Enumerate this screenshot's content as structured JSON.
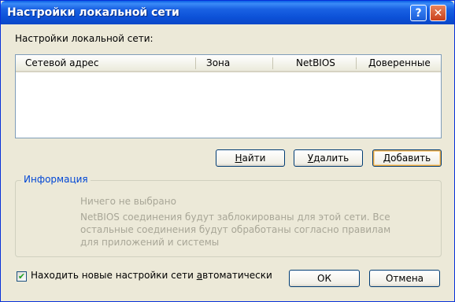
{
  "window": {
    "title": "Настройки локальной сети",
    "help_glyph": "?",
    "close_glyph": "✕"
  },
  "section_label": "Настройки локальной сети:",
  "table": {
    "columns": [
      "Сетевой адрес",
      "Зона",
      "NetBIOS",
      "Доверенные"
    ],
    "rows": []
  },
  "buttons": {
    "find": {
      "label_pre": "",
      "label_accel": "Н",
      "label_post": "айти"
    },
    "delete": {
      "label_pre": "",
      "label_accel": "У",
      "label_post": "далить"
    },
    "add": {
      "label_pre": "",
      "label_accel": "Д",
      "label_post": "обавить"
    },
    "ok": "ОК",
    "cancel": "Отмена"
  },
  "info": {
    "title": "Информация",
    "nothing_selected": "Ничего не выбрано",
    "lines": [
      "NetBIOS соединения будут заблокированы для этой сети. Все",
      "остальные соединения будут обработаны согласно правилам",
      "для приложений и системы"
    ]
  },
  "auto_detect": {
    "checked": true,
    "check_glyph": "✔",
    "label_pre": "Находить новые настройки сети ",
    "label_accel": "а",
    "label_post": "втоматически"
  },
  "colors": {
    "titlebar": "#0c51d8",
    "dialog_bg": "#ece9d8",
    "group_title": "#0046d5",
    "disabled_text": "#a8a697"
  }
}
